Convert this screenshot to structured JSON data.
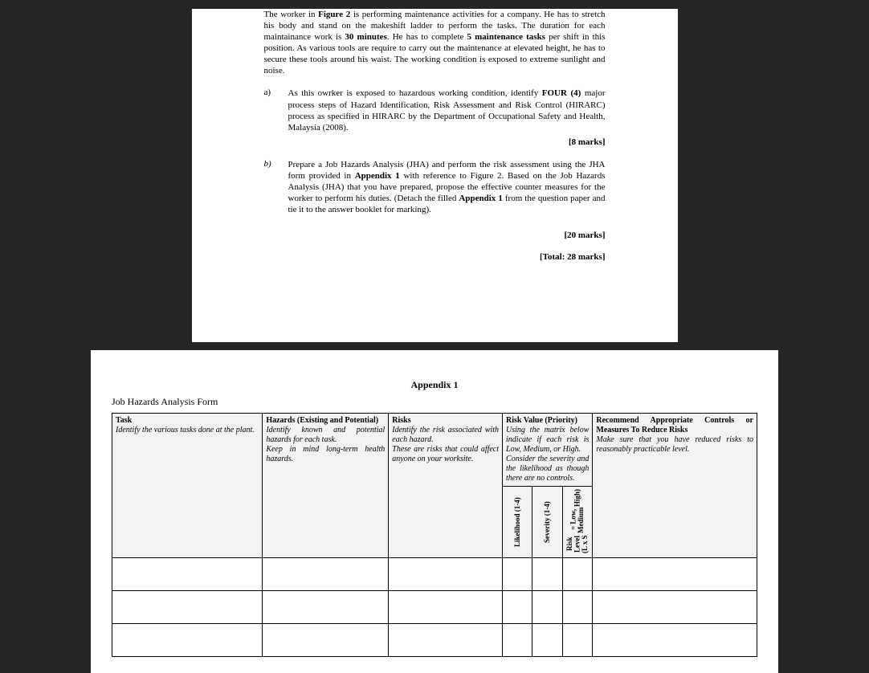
{
  "page1": {
    "intro_pre": "The worker in ",
    "intro_fig": "Figure 2",
    "intro_mid1": " is performing maintenance activities for a company. He has to stretch his body and stand on the makeshift ladder to perform the tasks. The duration for each maintainance work is ",
    "intro_dur": "30 minutes",
    "intro_mid2": ". He has to complete ",
    "intro_tasks": "5 maintenance tasks",
    "intro_post": " per shift in this position. As various tools are require to carry out the maintenance at elevated height, he has to secure these tools around his waist. The working condition is exposed to extreme sunlight and noise.",
    "a_label": "a)",
    "a_pre": "As this owrker is exposed to hazardous working condition, identify ",
    "a_four": "FOUR (4)",
    "a_post": " major process steps of Hazard Identification, Risk Assessment and Risk Control (HIRARC) process as specified in HIRARC by the Department of Occupational Safety and Health, Malaysia (2008).",
    "a_marks": "[8 marks]",
    "b_label": "b)",
    "b_pre": "Prepare a Job Hazards Analysis (JHA) and perform the risk assessment using the JHA form provided in ",
    "b_apx": "Appendix 1",
    "b_mid": " with reference to Figure 2. Based on the Job Hazards Analysis (JHA) that you have prepared, propose the effective counter measures for the worker to perform his duties. (Detach the filled ",
    "b_apx2": "Appendix 1",
    "b_post": " from the question paper and tie it to the answer booklet for marking).",
    "b_marks": "[20 marks]",
    "total": "[Total: 28 marks]"
  },
  "page2": {
    "appendix_title": "Appendix 1",
    "form_title": "Job Hazards Analysis Form",
    "headers": {
      "task_h": "Task",
      "task_d": "Identify the various tasks done at the plant.",
      "haz_h": "Hazards (Existing and Potential)",
      "haz_d1": "Identify known and potential hazards for each task.",
      "haz_d2": "Keep in mind long-term health hazards.",
      "risk_h": "Risks",
      "risk_d1": "Identify the risk associated with each hazard.",
      "risk_d2": "These are risks that could affect anyone on your worksite.",
      "rv_h": "Risk Value (Priority)",
      "rv_d1": "Using the matrix below indicate if each risk is Low, Medium, or High.",
      "rv_d2": "Consider the severity and the likelihood as though there are no controls.",
      "rec_h": "Recommend Appropriate Controls or Measures To Reduce Risks",
      "rec_d": "Make sure that you have reduced risks to reasonably practicable level.",
      "sub_like": "Likelihood (1-4)",
      "sub_sev": "Severity (1-4)",
      "sub_risk1": "Risk Level (L x S",
      "sub_risk2": "= Low, Medium",
      "sub_risk3": "High)"
    }
  }
}
